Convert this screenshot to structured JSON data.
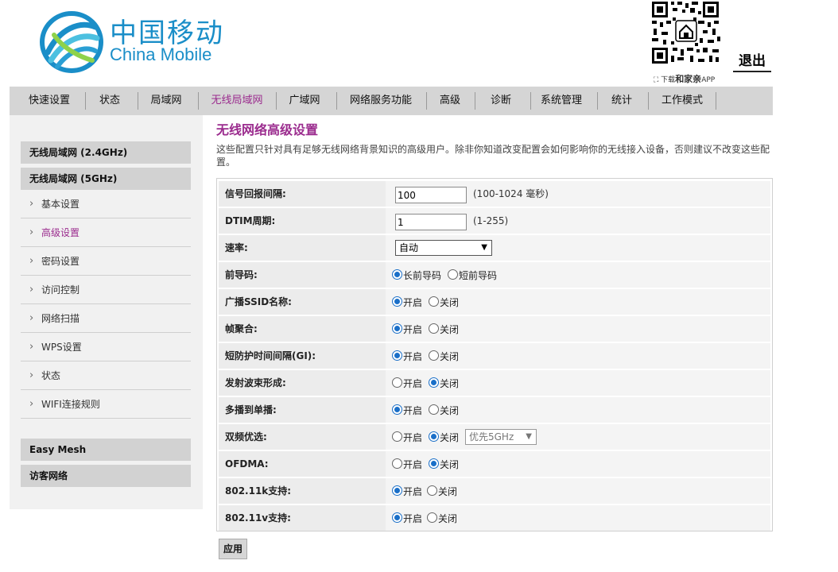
{
  "brand": {
    "name_cn": "中国移动",
    "name_en": "China Mobile",
    "color": "#1a8ec8"
  },
  "qr": {
    "caption_prefix": "下载",
    "caption_app": "和家亲",
    "caption_suffix": "APP"
  },
  "header": {
    "logout": "退出"
  },
  "nav": {
    "items": [
      "快速设置",
      "状态",
      "局域网",
      "无线局域网",
      "广域网",
      "网络服务功能",
      "高级",
      "诊断",
      "系统管理",
      "统计",
      "工作模式"
    ],
    "active": "无线局域网"
  },
  "sidebar": {
    "head_24g": "无线局域网 (2.4GHz)",
    "head_5g": "无线局域网 (5GHz)",
    "items": [
      "基本设置",
      "高级设置",
      "密码设置",
      "访问控制",
      "网络扫描",
      "WPS设置",
      "状态",
      "WIFI连接规则"
    ],
    "active": "高级设置",
    "easymesh": "Easy Mesh",
    "guest": "访客网络"
  },
  "page": {
    "title": "无线网络高级设置",
    "description": "这些配置只针对具有足够无线网络背景知识的高级用户。除非你知道改变配置会如何影响你的无线接入设备，否则建议不改变这些配置。"
  },
  "form": {
    "beacon": {
      "label": "信号回报间隔:",
      "value": "100",
      "hint": "(100-1024 毫秒)"
    },
    "dtim": {
      "label": "DTIM周期:",
      "value": "1",
      "hint": "(1-255)"
    },
    "rate": {
      "label": "速率:",
      "selected": "自动"
    },
    "preamble": {
      "label": "前导码:",
      "opt_long": "长前导码",
      "opt_short": "短前导码"
    },
    "ssid_broadcast": {
      "label": "广播SSID名称:",
      "on": "开启",
      "off": "关闭"
    },
    "aggregation": {
      "label": "帧聚合:",
      "on": "开启",
      "off": "关闭"
    },
    "short_gi": {
      "label": "短防护时间间隔(GI):",
      "on": "开启",
      "off": "关闭"
    },
    "beamforming": {
      "label": "发射波束形成:",
      "on": "开启",
      "off": "关闭"
    },
    "multicast": {
      "label": "多播到单播:",
      "on": "开启",
      "off": "关闭"
    },
    "band_steering": {
      "label": "双频优选:",
      "on": "开启",
      "off": "关闭",
      "selected": "优先5GHz"
    },
    "ofdma": {
      "label": "OFDMA:",
      "on": "开启",
      "off": "关闭"
    },
    "k11": {
      "label": "802.11k支持:",
      "on": "开启",
      "off": "关闭"
    },
    "v11": {
      "label": "802.11v支持:",
      "on": "开启",
      "off": "关闭"
    }
  },
  "apply": "应用",
  "colors": {
    "accent": "#9b2c8e",
    "nav_bg": "#d5d5d5",
    "radio": "#1a6fc8"
  }
}
